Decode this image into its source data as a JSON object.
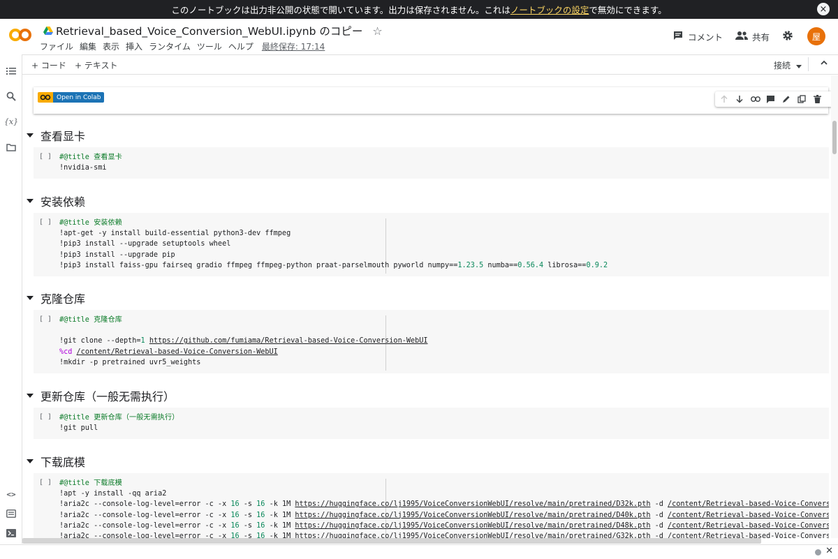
{
  "banner": {
    "text_before": "このノートブックは出力非公開の状態で開いています。出力は保存されません。これは",
    "link": "ノートブックの設定",
    "text_after": "で無効にできます。",
    "close": "×"
  },
  "header": {
    "title": "Retrieval_based_Voice_Conversion_WebUI.ipynb のコピー",
    "menu": [
      "ファイル",
      "編集",
      "表示",
      "挿入",
      "ランタイム",
      "ツール",
      "ヘルプ"
    ],
    "last_saved": "最終保存: 17:14",
    "comment_label": "コメント",
    "share_label": "共有",
    "avatar_initial": "屋"
  },
  "toolbar": {
    "add_code": "+ コード",
    "add_text": "+ テキスト",
    "connect": "接続"
  },
  "badge": {
    "label": "Open in Colab"
  },
  "sections": [
    {
      "title": "查看显卡",
      "run": "[ ]",
      "code": [
        [
          {
            "t": "#@title 查看显卡",
            "c": "cm"
          }
        ],
        [
          {
            "t": "!nvidia-smi"
          }
        ]
      ]
    },
    {
      "title": "安装依赖",
      "run": "[ ]",
      "code": [
        [
          {
            "t": "#@title 安装依赖",
            "c": "cm"
          }
        ],
        [
          {
            "t": "!apt-get -y install build-essential python3-dev ffmpeg"
          }
        ],
        [
          {
            "t": "!pip3 install --upgrade setuptools wheel"
          }
        ],
        [
          {
            "t": "!pip3 install --upgrade pip"
          }
        ],
        [
          {
            "t": "!pip3 install faiss-gpu fairseq gradio ffmpeg ffmpeg-python praat-parselmouth pyworld numpy=="
          },
          {
            "t": "1.23.5",
            "c": "num"
          },
          {
            "t": " numba=="
          },
          {
            "t": "0.56.4",
            "c": "num"
          },
          {
            "t": " librosa=="
          },
          {
            "t": "0.9.2",
            "c": "num"
          }
        ]
      ]
    },
    {
      "title": "克隆仓库",
      "run": "[ ]",
      "code": [
        [
          {
            "t": "#@title 克隆仓库",
            "c": "cm"
          }
        ],
        [
          {
            "t": ""
          }
        ],
        [
          {
            "t": "!git clone --depth="
          },
          {
            "t": "1",
            "c": "num"
          },
          {
            "t": " "
          },
          {
            "t": "https://github.com/fumiama/Retrieval-based-Voice-Conversion-WebUI",
            "c": "url"
          }
        ],
        [
          {
            "t": "%cd",
            "c": "mag"
          },
          {
            "t": " "
          },
          {
            "t": "/content/Retrieval-based-Voice-Conversion-WebUI",
            "c": "url"
          }
        ],
        [
          {
            "t": "!mkdir -p pretrained uvr5_weights"
          }
        ]
      ]
    },
    {
      "title": "更新仓库（一般无需执行）",
      "run": "[ ]",
      "code": [
        [
          {
            "t": "#@title 更新仓库（一般无需执行）",
            "c": "cm"
          }
        ],
        [
          {
            "t": "!git pull"
          }
        ]
      ]
    },
    {
      "title": "下载底模",
      "run": "[ ]",
      "code": [
        [
          {
            "t": "#@title 下载底模",
            "c": "cm"
          }
        ],
        [
          {
            "t": "!apt -y install -qq aria2"
          }
        ],
        [
          {
            "t": "!aria2c --console-log-level=error -c -x "
          },
          {
            "t": "16",
            "c": "num"
          },
          {
            "t": " -s "
          },
          {
            "t": "16",
            "c": "num"
          },
          {
            "t": " -k 1M "
          },
          {
            "t": "https://huggingface.co/lj1995/VoiceConversionWebUI/resolve/main/pretrained/D32k.pth",
            "c": "url"
          },
          {
            "t": " -d "
          },
          {
            "t": "/content/Retrieval-based-Voice-Conversion-WebUI/pretrained",
            "c": "url"
          }
        ],
        [
          {
            "t": "!aria2c --console-log-level=error -c -x "
          },
          {
            "t": "16",
            "c": "num"
          },
          {
            "t": " -s "
          },
          {
            "t": "16",
            "c": "num"
          },
          {
            "t": " -k 1M "
          },
          {
            "t": "https://huggingface.co/lj1995/VoiceConversionWebUI/resolve/main/pretrained/D40k.pth",
            "c": "url"
          },
          {
            "t": " -d "
          },
          {
            "t": "/content/Retrieval-based-Voice-Conversion-WebUI/pretrained",
            "c": "url"
          }
        ],
        [
          {
            "t": "!aria2c --console-log-level=error -c -x "
          },
          {
            "t": "16",
            "c": "num"
          },
          {
            "t": " -s "
          },
          {
            "t": "16",
            "c": "num"
          },
          {
            "t": " -k 1M "
          },
          {
            "t": "https://huggingface.co/lj1995/VoiceConversionWebUI/resolve/main/pretrained/D48k.pth",
            "c": "url"
          },
          {
            "t": " -d "
          },
          {
            "t": "/content/Retrieval-based-Voice-Conversion-WebUI/pretrained",
            "c": "url"
          }
        ],
        [
          {
            "t": "!aria2c --console-log-level=error -c -x "
          },
          {
            "t": "16",
            "c": "num"
          },
          {
            "t": " -s "
          },
          {
            "t": "16",
            "c": "num"
          },
          {
            "t": " -k 1M "
          },
          {
            "t": "https://huggingface.co/lj1995/VoiceConversionWebUI/resolve/main/pretrained/G32k.pth",
            "c": "url"
          },
          {
            "t": " -d "
          },
          {
            "t": "/content/Retrieval-based-Voice-Conversion-WebUI/pretrained",
            "c": "url"
          }
        ]
      ]
    }
  ]
}
